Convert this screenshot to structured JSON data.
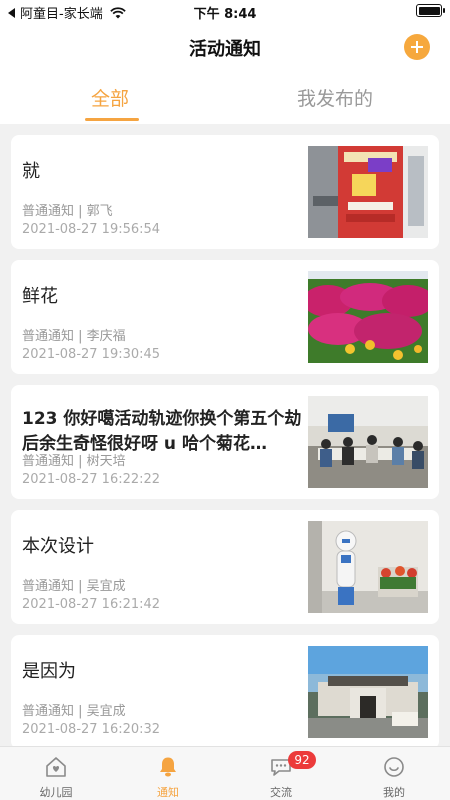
{
  "status_bar": {
    "carrier": "阿童目-家长端",
    "time": "下午 8:44"
  },
  "header": {
    "title": "活动通知",
    "add_icon": "plus-circle-icon"
  },
  "tabs": [
    {
      "label": "全部",
      "active": true
    },
    {
      "label": "我发布的",
      "active": false
    }
  ],
  "notices": [
    {
      "title": "就",
      "type": "普通通知",
      "author": "郭飞",
      "meta": "普通通知 | 郭飞",
      "time": "2021-08-27 19:56:54",
      "thumb": "poster-photo"
    },
    {
      "title": "鲜花",
      "type": "普通通知",
      "author": "李庆福",
      "meta": "普通通知 | 李庆福",
      "time": "2021-08-27 19:30:45",
      "thumb": "flowers-photo"
    },
    {
      "title": "123 你好噶活动轨迹你换个第五个劫后余生奇怪很好呀 u 哈个菊花…",
      "type": "普通通知",
      "author": "树天培",
      "meta": "普通通知 | 树天培",
      "time": "2021-08-27 16:22:22",
      "thumb": "meeting-photo"
    },
    {
      "title": "本次设计",
      "type": "普通通知",
      "author": "吴宜成",
      "meta": "普通通知 | 吴宜成",
      "time": "2021-08-27 16:21:42",
      "thumb": "robot-photo"
    },
    {
      "title": "是因为",
      "type": "普通通知",
      "author": "吴宜成",
      "meta": "普通通知 | 吴宜成",
      "time": "2021-08-27 16:20:32",
      "thumb": "building-photo"
    }
  ],
  "tab_bar": [
    {
      "label": "幼儿园",
      "icon": "house-heart-icon",
      "active": false
    },
    {
      "label": "通知",
      "icon": "bell-icon",
      "active": true
    },
    {
      "label": "交流",
      "icon": "chat-bubble-icon",
      "active": false,
      "badge": "92"
    },
    {
      "label": "我的",
      "icon": "smile-face-icon",
      "active": false
    }
  ],
  "colors": {
    "accent": "#f5a441",
    "badge": "#ec3b3b",
    "background": "#f1f1f1"
  }
}
